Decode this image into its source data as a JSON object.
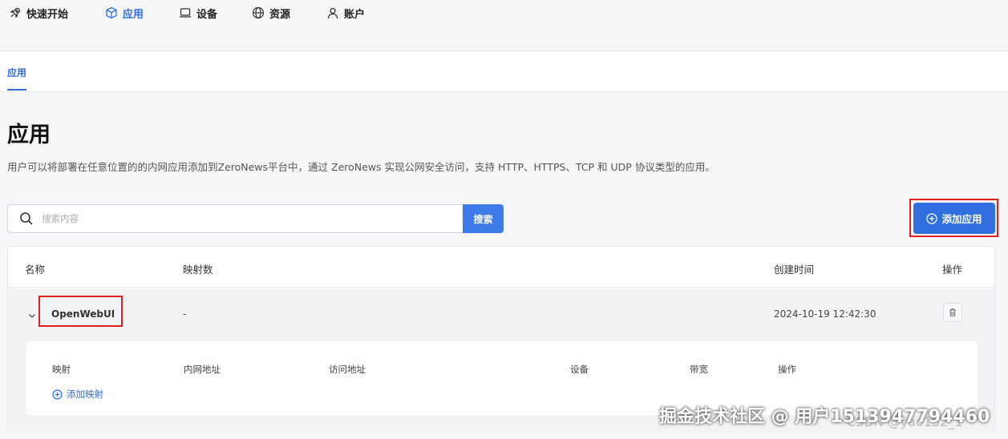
{
  "nav": {
    "items": [
      {
        "label": "快速开始",
        "icon": "rocket-icon"
      },
      {
        "label": "应用",
        "icon": "cube-icon",
        "active": true
      },
      {
        "label": "设备",
        "icon": "laptop-icon"
      },
      {
        "label": "资源",
        "icon": "globe-icon"
      },
      {
        "label": "账户",
        "icon": "user-icon"
      }
    ]
  },
  "subtab": {
    "label": "应用"
  },
  "page": {
    "title": "应用",
    "description": "用户可以将部署在任意位置的的内网应用添加到ZeroNews平台中，通过 ZeroNews 实现公网安全访问，支持 HTTP、HTTPS、TCP 和 UDP 协议类型的应用。"
  },
  "search": {
    "placeholder": "搜索内容",
    "button": "搜索"
  },
  "add_app": {
    "label": "添加应用"
  },
  "table": {
    "headers": {
      "name": "名称",
      "mappings": "映射数",
      "created": "创建时间",
      "actions": "操作"
    },
    "rows": [
      {
        "name": "OpenWebUI",
        "mappings": "-",
        "created": "2024-10-19 12:42:30"
      }
    ]
  },
  "mapping_table": {
    "headers": {
      "mapping": "映射",
      "internal": "内网地址",
      "access": "访问地址",
      "device": "设备",
      "bandwidth": "带宽",
      "actions": "操作"
    },
    "add_label": "添加映射"
  },
  "watermark": {
    "text": "掘金技术社区 @ 用户1513947794460",
    "secondary": "CSDN @yao132_1"
  },
  "colors": {
    "accent": "#2f6fe0",
    "highlight": "#e0201c"
  }
}
